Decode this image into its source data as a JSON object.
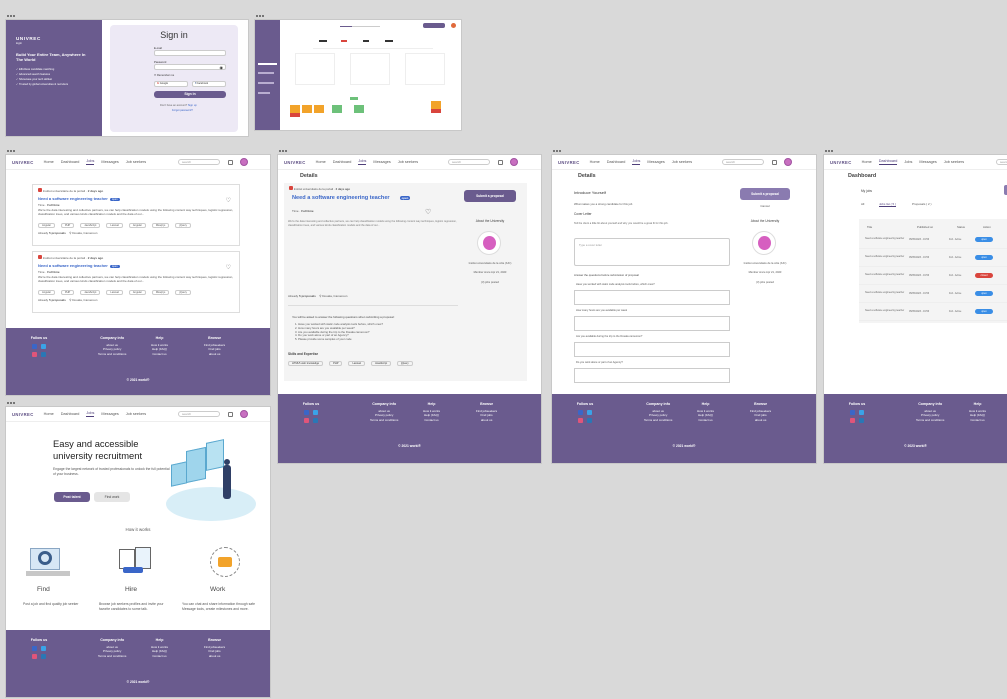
{
  "brand": "UNIVREC",
  "nav": {
    "home": "Home",
    "dashboard": "Dashboard",
    "jobs": "Jobs",
    "messages": "Messages",
    "job_seekers": "Job seekers",
    "search_placeholder": "search"
  },
  "signin": {
    "brand": "UNIVREC",
    "sub": "login",
    "headline": "Build Your Entire Team, Anywhere In The World",
    "bullets": [
      "Effortless candidate matching",
      "Advanced search features",
      "Showcase your tech skillset",
      "Trusted by global universities & recruiters"
    ],
    "title": "Sign in",
    "email_label": "E-mail",
    "password_label": "Password",
    "remember": "Remember me",
    "google": "Google",
    "facebook": "Facebook",
    "button": "Sign in",
    "no_account": "Don't have an account?",
    "signup": "Sign up",
    "forgot": "Forgot password?"
  },
  "job": {
    "univ": "Institut universitaire de la portail",
    "posted": "2 days ago",
    "title": "Need a software engineering teacher",
    "badge": "open",
    "mode_label": "Time",
    "mode": "Full time",
    "desc": "We're the data interesting and collective partners, we can help classification models using the following content way techniques, logistic regression, classification trees, and various kinds classification models and the data of our...",
    "tags": [
      "Angular",
      "PHP",
      "JavaScript",
      "Laravel",
      "Angular",
      "Mssql.js",
      "jQuery"
    ],
    "already": "Already",
    "proposals": "5 proposals",
    "location": "Douala, Cameroon"
  },
  "footer": {
    "follow": "Follow us",
    "company": "Company info",
    "company_items": [
      "about us",
      "Privacy policy",
      "Terms and conditions"
    ],
    "help": "Help",
    "help_items": [
      "How it works",
      "Help (FAQ)",
      "Contact us"
    ],
    "browse": "Browse",
    "browse_items": [
      "Find jobseekers",
      "Find jobs",
      "about us"
    ],
    "copy": "© 2021 worki®",
    "copy2": "© 2023 worki®"
  },
  "landing": {
    "headline": "Easy and accessible university recruitment",
    "sub": "Engage the largest network of trusted professionals to unlock the full potential of your business.",
    "primary": "Post talent",
    "secondary": "Find work",
    "how": "How it works",
    "steps": [
      {
        "title": "Find",
        "text": "Post a job and find quality job seeker"
      },
      {
        "title": "Hire",
        "text": "Browse job seekers profiles and invite your favorite candidates to some talk."
      },
      {
        "title": "Work",
        "text": "You can chat and share information through safe Message tools, create milestones and more."
      }
    ]
  },
  "details": {
    "heading": "Details",
    "submit": "Submit a proposal",
    "cancel": "Cancel",
    "about": "About the University",
    "inst": "Institut universitaire de la côte (IUC)",
    "member": "Member since Apr 21, 2023",
    "posted_jobs": "(3) jobs posted",
    "questions_intro": "You will be asked to answer the following questions when submitting a proposal:",
    "questions": [
      "Have you worked with static code analysis tools before, which ones?",
      "How many hours are you available per week?",
      "Are you available during the trip to the Douala cameroon?",
      "Do you work alone or part of an Agency?",
      "Please provide some samples of your code"
    ],
    "skills": "Skills and Expertise",
    "skills_tags": [
      "HTML5 web knowledge",
      "PHP",
      "Laravel",
      "JavaScript",
      "jQuery"
    ],
    "intro": "Introduce Yourself",
    "intro_sub": "What makes you a strong candidate for this job",
    "cover": "Cover Letter",
    "cover_hint": "Tell the client a little bit about yourself and why you would be a great fit for this job.",
    "cover_placeholder": "Type a cover letter",
    "answer": "Answer the questions before submission of proposal",
    "q1": "Have you worked with static code analysis tools before, which ones?",
    "q2": "How many hours are you available per week",
    "q3": "Are you available during the trip to the Douala cameroon?",
    "q4": "Do you work alone or part of an Agency?"
  },
  "dash": {
    "heading": "Dashboard",
    "myjobs": "My jobs",
    "all": "All",
    "jobs_list": "Jobs list ( 5 )",
    "proposals_tab": "Proposals ( 2 )",
    "cols": [
      "Title",
      "Published on",
      "Status",
      "Action"
    ],
    "row_title": "Need a software engineering teacher",
    "row_date": "05/05/2023 - 19:56",
    "row_status": "Full - Active",
    "actions": [
      "open",
      "open",
      "closed",
      "open",
      "open"
    ]
  },
  "colors": {
    "primary": "#6a5b8e",
    "accent": "#3a66c8",
    "danger": "#d9453d"
  }
}
